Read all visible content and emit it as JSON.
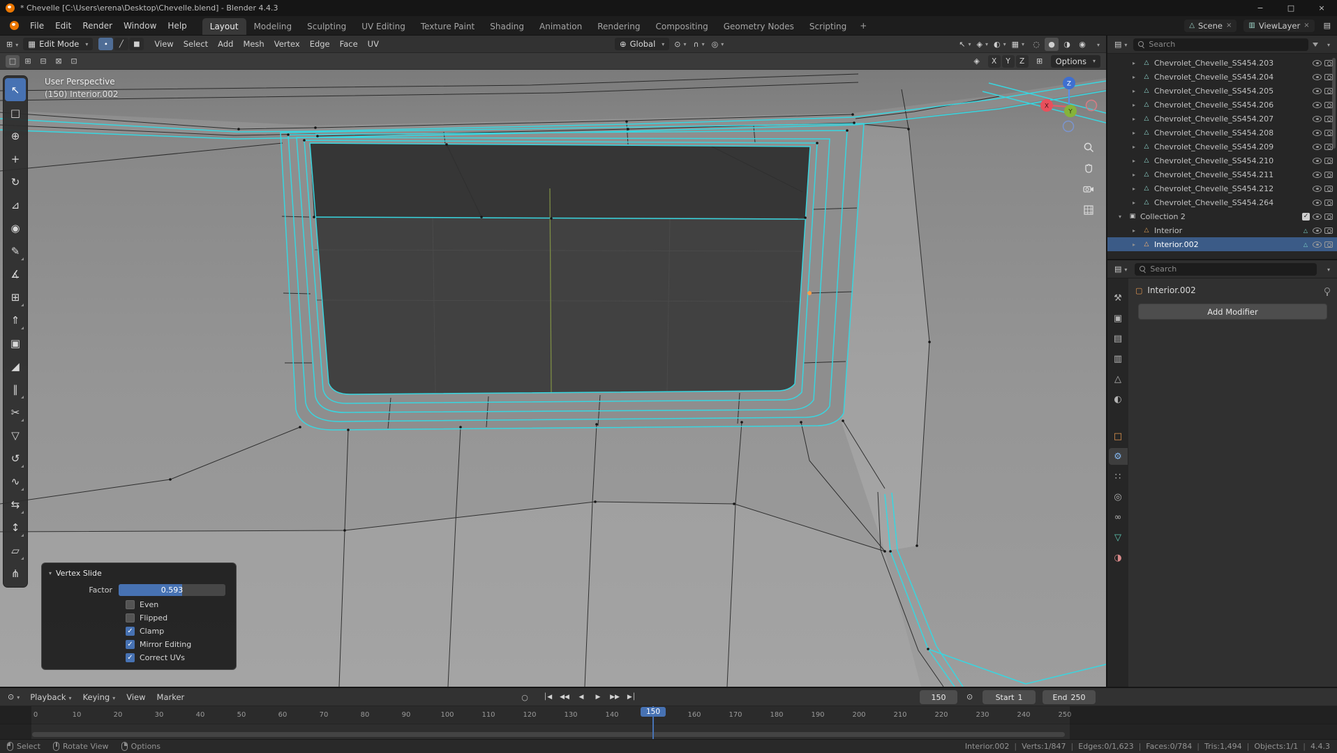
{
  "colors": {
    "accent_blue": "#4772b3",
    "edge_highlight": "#38d6e0",
    "active_vertex": "#ff9d45",
    "selection_row": "#3b5b87",
    "active_object_icon": "#ffb46e"
  },
  "window": {
    "title": "* Chevelle [C:\\Users\\erena\\Desktop\\Chevelle.blend] - Blender 4.4.3",
    "minimize_glyph": "−",
    "maximize_glyph": "□",
    "close_glyph": "×"
  },
  "topbar": {
    "menus": [
      {
        "name": "menu-file",
        "label": "File"
      },
      {
        "name": "menu-edit",
        "label": "Edit"
      },
      {
        "name": "menu-render",
        "label": "Render"
      },
      {
        "name": "menu-window",
        "label": "Window"
      },
      {
        "name": "menu-help",
        "label": "Help"
      }
    ],
    "workspaces": [
      {
        "name": "tab-layout",
        "label": "Layout",
        "active": true
      },
      {
        "name": "tab-modeling",
        "label": "Modeling"
      },
      {
        "name": "tab-sculpting",
        "label": "Sculpting"
      },
      {
        "name": "tab-uv-editing",
        "label": "UV Editing"
      },
      {
        "name": "tab-texture-paint",
        "label": "Texture Paint"
      },
      {
        "name": "tab-shading",
        "label": "Shading"
      },
      {
        "name": "tab-animation",
        "label": "Animation"
      },
      {
        "name": "tab-rendering",
        "label": "Rendering"
      },
      {
        "name": "tab-compositing",
        "label": "Compositing"
      },
      {
        "name": "tab-geometry-nodes",
        "label": "Geometry Nodes"
      },
      {
        "name": "tab-scripting",
        "label": "Scripting"
      }
    ],
    "add_tab_glyph": "+",
    "scene": {
      "icon_glyph": "△",
      "label": "Scene",
      "unlink_glyph": "×"
    },
    "viewlayer": {
      "icon_glyph": "▥",
      "label": "ViewLayer",
      "unlink_glyph": "×"
    },
    "corner_icon_glyph": "▤"
  },
  "viewport_header": {
    "editor_icon_glyph": "⊞",
    "mode": {
      "icon_glyph": "▦",
      "label": "Edit Mode"
    },
    "select_modes": [
      {
        "name": "vertex-select-mode",
        "glyph": "∙",
        "active": true
      },
      {
        "name": "edge-select-mode",
        "glyph": "╱"
      },
      {
        "name": "face-select-mode",
        "glyph": "■"
      }
    ],
    "menus": [
      {
        "name": "menu-view",
        "label": "View"
      },
      {
        "name": "menu-select",
        "label": "Select"
      },
      {
        "name": "menu-add",
        "label": "Add"
      },
      {
        "name": "menu-mesh",
        "label": "Mesh"
      },
      {
        "name": "menu-vertex",
        "label": "Vertex"
      },
      {
        "name": "menu-edge",
        "label": "Edge"
      },
      {
        "name": "menu-face",
        "label": "Face"
      },
      {
        "name": "menu-uv",
        "label": "UV"
      }
    ],
    "orientation": {
      "icon_glyph": "⊕",
      "label": "Global"
    },
    "pivot_glyph": "⊙",
    "snap_glyph": "∩",
    "proportional_glyph": "◎",
    "right_icons": [
      {
        "name": "visibility-dropdown-icon",
        "glyph": "↖"
      },
      {
        "name": "gizmos-dropdown-icon",
        "glyph": "◈"
      },
      {
        "name": "overlays-dropdown-icon",
        "glyph": "◐"
      },
      {
        "name": "xray-toggle-icon",
        "glyph": "▦"
      }
    ],
    "shading_modes": [
      {
        "name": "wireframe-shading-icon",
        "glyph": "◌"
      },
      {
        "name": "solid-shading-icon",
        "glyph": "●",
        "active": true
      },
      {
        "name": "material-shading-icon",
        "glyph": "◑"
      },
      {
        "name": "rendered-shading-icon",
        "glyph": "◉"
      }
    ]
  },
  "viewport_row2": {
    "select_ops": [
      {
        "name": "select-set-mode",
        "glyph": "□",
        "active": true
      },
      {
        "name": "select-extend-mode",
        "glyph": "⊞"
      },
      {
        "name": "select-subtract-mode",
        "glyph": "⊟"
      },
      {
        "name": "select-invert-mode",
        "glyph": "⊠"
      },
      {
        "name": "select-intersect-mode",
        "glyph": "⊡"
      }
    ],
    "gizmo_toggle_glyph": "◈",
    "axes": [
      {
        "name": "axis-x-button",
        "label": "X"
      },
      {
        "name": "axis-y-button",
        "label": "Y"
      },
      {
        "name": "axis-z-button",
        "label": "Z"
      }
    ],
    "snap_widget_glyph": "⊞",
    "options_label": "Options"
  },
  "viewport": {
    "overlay_line1": "User Perspective",
    "overlay_line2": "(150) Interior.002",
    "gizmo": {
      "x": "X",
      "y": "Y",
      "z": "Z"
    }
  },
  "toolbar": {
    "tools": [
      {
        "name": "tweak-tool",
        "glyph": "↖",
        "active": true
      },
      {
        "name": "select-box-tool",
        "glyph": "□"
      },
      {
        "name": "cursor-tool",
        "glyph": "⊕"
      },
      {
        "name": "move-tool",
        "glyph": "+"
      },
      {
        "name": "rotate-tool",
        "glyph": "↻"
      },
      {
        "name": "scale-tool",
        "glyph": "⊿"
      },
      {
        "name": "transform-tool",
        "glyph": "◉"
      },
      {
        "name": "annotate-tool",
        "glyph": "✎",
        "sub": true
      },
      {
        "name": "measure-tool",
        "glyph": "∡"
      },
      {
        "name": "add-cube-tool",
        "glyph": "⊞",
        "sub": true
      },
      {
        "name": "extrude-region-tool",
        "glyph": "⇑",
        "sub": true
      },
      {
        "name": "inset-faces-tool",
        "glyph": "▣"
      },
      {
        "name": "bevel-tool",
        "glyph": "◢"
      },
      {
        "name": "loop-cut-tool",
        "glyph": "∥",
        "sub": true
      },
      {
        "name": "knife-tool",
        "glyph": "✂",
        "sub": true
      },
      {
        "name": "poly-build-tool",
        "glyph": "▽"
      },
      {
        "name": "spin-tool",
        "glyph": "↺",
        "sub": true
      },
      {
        "name": "smooth-tool",
        "glyph": "∿",
        "sub": true
      },
      {
        "name": "edge-slide-tool",
        "glyph": "⇆",
        "sub": true
      },
      {
        "name": "shrink-fatten-tool",
        "glyph": "↕",
        "sub": true
      },
      {
        "name": "shear-tool",
        "glyph": "▱",
        "sub": true
      },
      {
        "name": "rip-region-tool",
        "glyph": "⋔"
      }
    ]
  },
  "vertex_slide": {
    "title": "Vertex Slide",
    "factor_label": "Factor",
    "factor_value": "0.593",
    "options": [
      {
        "label": "Even",
        "checked": false
      },
      {
        "label": "Flipped",
        "checked": false
      },
      {
        "label": "Clamp",
        "checked": true
      },
      {
        "label": "Mirror Editing",
        "checked": true
      },
      {
        "label": "Correct UVs",
        "checked": true
      }
    ]
  },
  "outliner": {
    "search_placeholder": "Search",
    "display_mode_glyph": "▤",
    "items": [
      {
        "label": "Chevrolet_Chevelle_SS454.203",
        "chevron": "▸",
        "icon_glyph": "△",
        "icon_name": "mesh-object-icon",
        "icon_color": "#8fd8cf",
        "indent": true
      },
      {
        "label": "Chevrolet_Chevelle_SS454.204",
        "chevron": "▸",
        "icon_glyph": "△",
        "icon_name": "mesh-object-icon",
        "icon_color": "#8fd8cf",
        "indent": true
      },
      {
        "label": "Chevrolet_Chevelle_SS454.205",
        "chevron": "▸",
        "icon_glyph": "△",
        "icon_name": "mesh-object-icon",
        "icon_color": "#8fd8cf",
        "indent": true
      },
      {
        "label": "Chevrolet_Chevelle_SS454.206",
        "chevron": "▸",
        "icon_glyph": "△",
        "icon_name": "mesh-object-icon",
        "icon_color": "#8fd8cf",
        "indent": true
      },
      {
        "label": "Chevrolet_Chevelle_SS454.207",
        "chevron": "▸",
        "icon_glyph": "△",
        "icon_name": "mesh-object-icon",
        "icon_color": "#8fd8cf",
        "indent": true
      },
      {
        "label": "Chevrolet_Chevelle_SS454.208",
        "chevron": "▸",
        "icon_glyph": "△",
        "icon_name": "mesh-object-icon",
        "icon_color": "#8fd8cf",
        "indent": true
      },
      {
        "label": "Chevrolet_Chevelle_SS454.209",
        "chevron": "▸",
        "icon_glyph": "△",
        "icon_name": "mesh-object-icon",
        "icon_color": "#8fd8cf",
        "indent": true
      },
      {
        "label": "Chevrolet_Chevelle_SS454.210",
        "chevron": "▸",
        "icon_glyph": "△",
        "icon_name": "mesh-object-icon",
        "icon_color": "#8fd8cf",
        "indent": true
      },
      {
        "label": "Chevrolet_Chevelle_SS454.211",
        "chevron": "▸",
        "icon_glyph": "△",
        "icon_name": "mesh-object-icon",
        "icon_color": "#8fd8cf",
        "indent": true
      },
      {
        "label": "Chevrolet_Chevelle_SS454.212",
        "chevron": "▸",
        "icon_glyph": "△",
        "icon_name": "mesh-object-icon",
        "icon_color": "#8fd8cf",
        "indent": true
      },
      {
        "label": "Chevrolet_Chevelle_SS454.264",
        "chevron": "▸",
        "icon_glyph": "△",
        "icon_name": "mesh-object-icon",
        "icon_color": "#8fd8cf",
        "indent": true
      },
      {
        "label": "Collection 2",
        "chevron": "▾",
        "icon_glyph": "▣",
        "icon_name": "collection-icon",
        "icon_color": "#c8c8c8",
        "checkbox": true
      },
      {
        "label": "Interior",
        "chevron": "▸",
        "icon_glyph": "△",
        "icon_name": "object-icon",
        "icon_color": "#dca05a",
        "indent": true,
        "badge_glyph": "△"
      },
      {
        "label": "Interior.002",
        "chevron": "▸",
        "icon_glyph": "△",
        "icon_name": "object-icon",
        "icon_color": "#ffb46e",
        "indent": true,
        "selected": true,
        "badge_glyph": "△"
      }
    ]
  },
  "properties": {
    "editor_icon_glyph": "▤",
    "search_placeholder": "Search",
    "tabs": [
      {
        "name": "tool-tab",
        "glyph": "⚒"
      },
      {
        "name": "render-tab",
        "glyph": "▣"
      },
      {
        "name": "output-tab",
        "glyph": "▤"
      },
      {
        "name": "view-layer-tab",
        "glyph": "▥"
      },
      {
        "name": "scene-tab",
        "glyph": "△"
      },
      {
        "name": "world-tab",
        "glyph": "◐"
      },
      {
        "name": "object-tab",
        "glyph": "□",
        "color": "#e0954f",
        "gap": true
      },
      {
        "name": "modifiers-tab",
        "glyph": "⚙",
        "color": "#84b7f0",
        "active": true
      },
      {
        "name": "particles-tab",
        "glyph": "∷"
      },
      {
        "name": "physics-tab",
        "glyph": "◎"
      },
      {
        "name": "constraints-tab",
        "glyph": "∞"
      },
      {
        "name": "object-data-tab",
        "glyph": "▽",
        "color": "#5fc9b4"
      },
      {
        "name": "material-tab",
        "glyph": "◑",
        "color": "#d98a8a"
      }
    ],
    "breadcrumb": {
      "icon_glyph": "▢",
      "label": "Interior.002"
    },
    "add_modifier_label": "Add Modifier"
  },
  "timeline": {
    "editor_icon_glyph": "⊙",
    "menus": [
      {
        "name": "playback-menu",
        "label": "Playback",
        "caret": true
      },
      {
        "name": "keying-menu",
        "label": "Keying",
        "caret": true
      },
      {
        "name": "view-menu",
        "label": "View"
      },
      {
        "name": "marker-menu",
        "label": "Marker"
      }
    ],
    "autokey_glyph": "○",
    "transport": [
      {
        "name": "jump-to-start-button",
        "glyph": "│◀"
      },
      {
        "name": "prev-keyframe-button",
        "glyph": "◀◀"
      },
      {
        "name": "play-reverse-button",
        "glyph": "◀"
      },
      {
        "name": "play-button",
        "glyph": "▶"
      },
      {
        "name": "next-keyframe-button",
        "glyph": "▶▶"
      },
      {
        "name": "jump-to-end-button",
        "glyph": "▶│"
      }
    ],
    "frame_field_value": "150",
    "current_frame": "150",
    "clock_glyph": "⊙",
    "start_label": "Start",
    "start_value": "1",
    "end_label": "End",
    "end_value": "250",
    "ticks": [
      0,
      10,
      20,
      30,
      40,
      50,
      60,
      70,
      80,
      90,
      100,
      110,
      120,
      130,
      140,
      150,
      160,
      170,
      180,
      190,
      200,
      210,
      220,
      230,
      240,
      250
    ]
  },
  "statusbar": {
    "hints": [
      {
        "name": "select-hint",
        "label": "Select",
        "lmb": true
      },
      {
        "name": "rotate-view-hint",
        "label": "Rotate View",
        "mmb": true
      },
      {
        "name": "options-hint",
        "label": "Options",
        "rmb": true
      }
    ],
    "stats": [
      "Interior.002",
      "Verts:1/847",
      "Edges:0/1,623",
      "Faces:0/784",
      "Tris:1,494",
      "Objects:1/1",
      "4.4.3"
    ]
  }
}
